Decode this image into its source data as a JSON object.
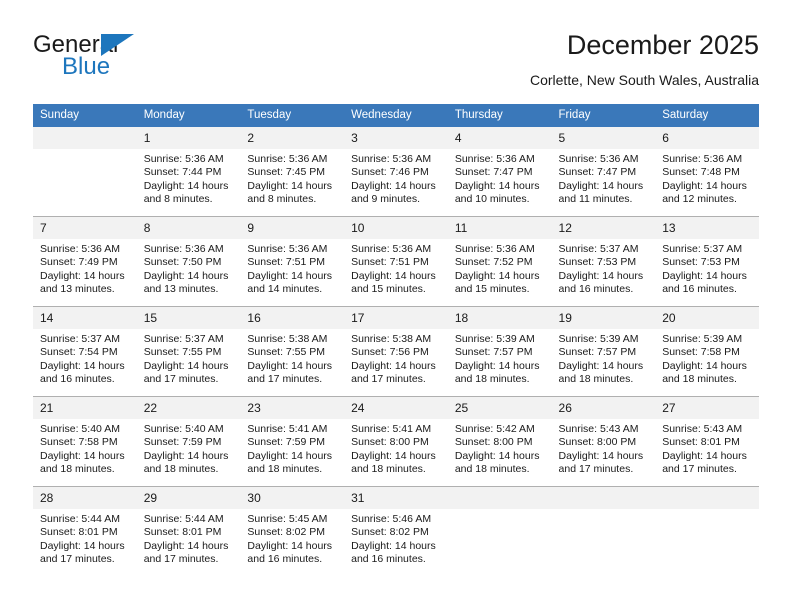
{
  "branding": {
    "name_part1": "General",
    "name_part2": "Blue",
    "triangle_icon": "triangle-icon",
    "accent_color": "#1d76bd"
  },
  "header": {
    "title": "December 2025",
    "subtitle": "Corlette, New South Wales, Australia"
  },
  "calendar": {
    "header_color": "#3a78ba",
    "daynum_background": "#f2f2f2",
    "weekday_headers": [
      "Sunday",
      "Monday",
      "Tuesday",
      "Wednesday",
      "Thursday",
      "Friday",
      "Saturday"
    ],
    "weeks": [
      [
        {
          "day": "",
          "blank": true,
          "sunrise": "",
          "sunset": "",
          "daylight": ""
        },
        {
          "day": "1",
          "sunrise": "Sunrise: 5:36 AM",
          "sunset": "Sunset: 7:44 PM",
          "daylight": "Daylight: 14 hours and 8 minutes."
        },
        {
          "day": "2",
          "sunrise": "Sunrise: 5:36 AM",
          "sunset": "Sunset: 7:45 PM",
          "daylight": "Daylight: 14 hours and 8 minutes."
        },
        {
          "day": "3",
          "sunrise": "Sunrise: 5:36 AM",
          "sunset": "Sunset: 7:46 PM",
          "daylight": "Daylight: 14 hours and 9 minutes."
        },
        {
          "day": "4",
          "sunrise": "Sunrise: 5:36 AM",
          "sunset": "Sunset: 7:47 PM",
          "daylight": "Daylight: 14 hours and 10 minutes."
        },
        {
          "day": "5",
          "sunrise": "Sunrise: 5:36 AM",
          "sunset": "Sunset: 7:47 PM",
          "daylight": "Daylight: 14 hours and 11 minutes."
        },
        {
          "day": "6",
          "sunrise": "Sunrise: 5:36 AM",
          "sunset": "Sunset: 7:48 PM",
          "daylight": "Daylight: 14 hours and 12 minutes."
        }
      ],
      [
        {
          "day": "7",
          "sunrise": "Sunrise: 5:36 AM",
          "sunset": "Sunset: 7:49 PM",
          "daylight": "Daylight: 14 hours and 13 minutes."
        },
        {
          "day": "8",
          "sunrise": "Sunrise: 5:36 AM",
          "sunset": "Sunset: 7:50 PM",
          "daylight": "Daylight: 14 hours and 13 minutes."
        },
        {
          "day": "9",
          "sunrise": "Sunrise: 5:36 AM",
          "sunset": "Sunset: 7:51 PM",
          "daylight": "Daylight: 14 hours and 14 minutes."
        },
        {
          "day": "10",
          "sunrise": "Sunrise: 5:36 AM",
          "sunset": "Sunset: 7:51 PM",
          "daylight": "Daylight: 14 hours and 15 minutes."
        },
        {
          "day": "11",
          "sunrise": "Sunrise: 5:36 AM",
          "sunset": "Sunset: 7:52 PM",
          "daylight": "Daylight: 14 hours and 15 minutes."
        },
        {
          "day": "12",
          "sunrise": "Sunrise: 5:37 AM",
          "sunset": "Sunset: 7:53 PM",
          "daylight": "Daylight: 14 hours and 16 minutes."
        },
        {
          "day": "13",
          "sunrise": "Sunrise: 5:37 AM",
          "sunset": "Sunset: 7:53 PM",
          "daylight": "Daylight: 14 hours and 16 minutes."
        }
      ],
      [
        {
          "day": "14",
          "sunrise": "Sunrise: 5:37 AM",
          "sunset": "Sunset: 7:54 PM",
          "daylight": "Daylight: 14 hours and 16 minutes."
        },
        {
          "day": "15",
          "sunrise": "Sunrise: 5:37 AM",
          "sunset": "Sunset: 7:55 PM",
          "daylight": "Daylight: 14 hours and 17 minutes."
        },
        {
          "day": "16",
          "sunrise": "Sunrise: 5:38 AM",
          "sunset": "Sunset: 7:55 PM",
          "daylight": "Daylight: 14 hours and 17 minutes."
        },
        {
          "day": "17",
          "sunrise": "Sunrise: 5:38 AM",
          "sunset": "Sunset: 7:56 PM",
          "daylight": "Daylight: 14 hours and 17 minutes."
        },
        {
          "day": "18",
          "sunrise": "Sunrise: 5:39 AM",
          "sunset": "Sunset: 7:57 PM",
          "daylight": "Daylight: 14 hours and 18 minutes."
        },
        {
          "day": "19",
          "sunrise": "Sunrise: 5:39 AM",
          "sunset": "Sunset: 7:57 PM",
          "daylight": "Daylight: 14 hours and 18 minutes."
        },
        {
          "day": "20",
          "sunrise": "Sunrise: 5:39 AM",
          "sunset": "Sunset: 7:58 PM",
          "daylight": "Daylight: 14 hours and 18 minutes."
        }
      ],
      [
        {
          "day": "21",
          "sunrise": "Sunrise: 5:40 AM",
          "sunset": "Sunset: 7:58 PM",
          "daylight": "Daylight: 14 hours and 18 minutes."
        },
        {
          "day": "22",
          "sunrise": "Sunrise: 5:40 AM",
          "sunset": "Sunset: 7:59 PM",
          "daylight": "Daylight: 14 hours and 18 minutes."
        },
        {
          "day": "23",
          "sunrise": "Sunrise: 5:41 AM",
          "sunset": "Sunset: 7:59 PM",
          "daylight": "Daylight: 14 hours and 18 minutes."
        },
        {
          "day": "24",
          "sunrise": "Sunrise: 5:41 AM",
          "sunset": "Sunset: 8:00 PM",
          "daylight": "Daylight: 14 hours and 18 minutes."
        },
        {
          "day": "25",
          "sunrise": "Sunrise: 5:42 AM",
          "sunset": "Sunset: 8:00 PM",
          "daylight": "Daylight: 14 hours and 18 minutes."
        },
        {
          "day": "26",
          "sunrise": "Sunrise: 5:43 AM",
          "sunset": "Sunset: 8:00 PM",
          "daylight": "Daylight: 14 hours and 17 minutes."
        },
        {
          "day": "27",
          "sunrise": "Sunrise: 5:43 AM",
          "sunset": "Sunset: 8:01 PM",
          "daylight": "Daylight: 14 hours and 17 minutes."
        }
      ],
      [
        {
          "day": "28",
          "sunrise": "Sunrise: 5:44 AM",
          "sunset": "Sunset: 8:01 PM",
          "daylight": "Daylight: 14 hours and 17 minutes."
        },
        {
          "day": "29",
          "sunrise": "Sunrise: 5:44 AM",
          "sunset": "Sunset: 8:01 PM",
          "daylight": "Daylight: 14 hours and 17 minutes."
        },
        {
          "day": "30",
          "sunrise": "Sunrise: 5:45 AM",
          "sunset": "Sunset: 8:02 PM",
          "daylight": "Daylight: 14 hours and 16 minutes."
        },
        {
          "day": "31",
          "sunrise": "Sunrise: 5:46 AM",
          "sunset": "Sunset: 8:02 PM",
          "daylight": "Daylight: 14 hours and 16 minutes."
        },
        {
          "day": "",
          "blank": true,
          "sunrise": "",
          "sunset": "",
          "daylight": ""
        },
        {
          "day": "",
          "blank": true,
          "sunrise": "",
          "sunset": "",
          "daylight": ""
        },
        {
          "day": "",
          "blank": true,
          "sunrise": "",
          "sunset": "",
          "daylight": ""
        }
      ]
    ]
  }
}
